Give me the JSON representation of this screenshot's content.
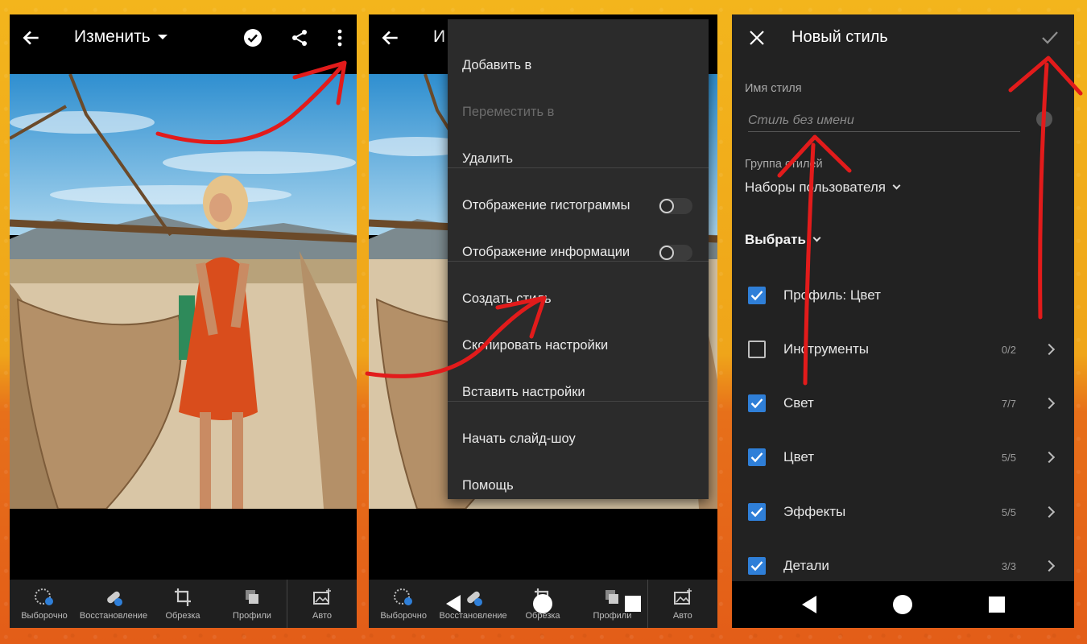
{
  "panel1": {
    "title": "Изменить",
    "toolbar": [
      "Выборочно",
      "Восстановление",
      "Обрезка",
      "Профили",
      "Авто"
    ]
  },
  "panel2": {
    "title_partial": "И",
    "menu": [
      {
        "label": "Добавить в",
        "enabled": true
      },
      {
        "label": "Переместить в",
        "enabled": false
      },
      {
        "label": "Удалить",
        "enabled": true
      },
      {
        "label": "Отображение гистограммы",
        "toggle": false
      },
      {
        "label": "Отображение информации",
        "toggle": false
      },
      {
        "label": "Создать стиль",
        "enabled": true
      },
      {
        "label": "Скопировать настройки",
        "enabled": true
      },
      {
        "label": "Вставить настройки",
        "enabled": true
      },
      {
        "label": "Начать слайд-шоу",
        "enabled": true
      },
      {
        "label": "Помощь",
        "enabled": true
      }
    ],
    "toolbar": [
      "Выборочно",
      "Восстановление",
      "Обрезка",
      "Профили",
      "Авто"
    ]
  },
  "panel3": {
    "title": "Новый стиль",
    "name_label": "Имя стиля",
    "name_placeholder": "Стиль без имени",
    "group_label": "Группа стилей",
    "group_value": "Наборы пользователя",
    "select_label": "Выбрать",
    "rows": [
      {
        "label": "Профиль: Цвет",
        "checked": true,
        "count": ""
      },
      {
        "label": "Инструменты",
        "checked": false,
        "count": "0/2"
      },
      {
        "label": "Свет",
        "checked": true,
        "count": "7/7"
      },
      {
        "label": "Цвет",
        "checked": true,
        "count": "5/5"
      },
      {
        "label": "Эффекты",
        "checked": true,
        "count": "5/5"
      },
      {
        "label": "Детали",
        "checked": true,
        "count": "3/3"
      }
    ]
  },
  "colors": {
    "accent_checkbox": "#2f7fd8",
    "annotation_arrow": "#e21b1b",
    "background_top": "#f3b51c",
    "background_bottom": "#e35d18"
  }
}
